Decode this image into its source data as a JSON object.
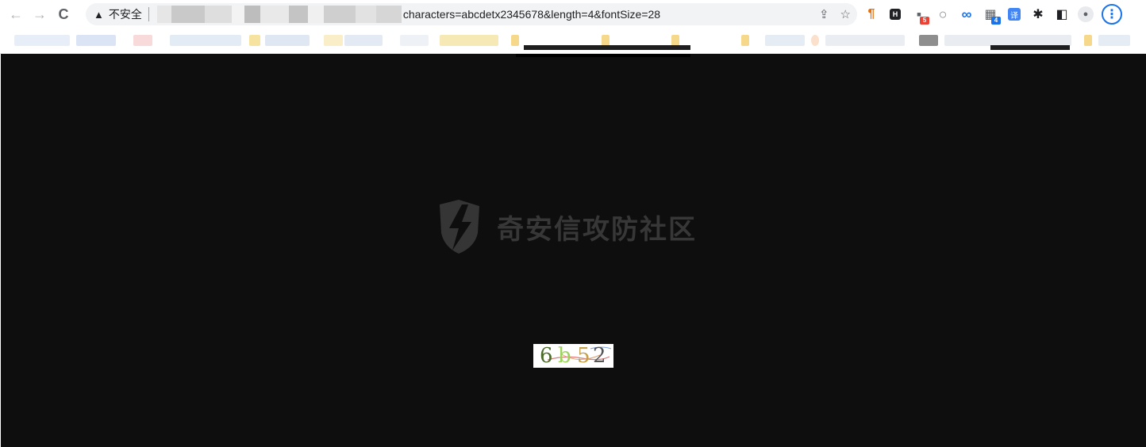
{
  "browser": {
    "nav": {
      "back_icon": "←",
      "forward_icon": "→",
      "reload_icon": "C"
    },
    "omnibox": {
      "security_icon": "▲",
      "security_label": "不安全",
      "url_visible": "characters=abcdetx2345678&length=4&fontSize=28",
      "share_icon": "⇪",
      "star_icon": "☆"
    },
    "extensions": [
      {
        "name": "pilcrow",
        "glyph": "¶",
        "color": "#e8710a",
        "badge": ""
      },
      {
        "name": "h-box",
        "glyph": "H",
        "color": "#202124",
        "badge": ""
      },
      {
        "name": "grid",
        "glyph": "▪",
        "color": "#5f6368",
        "badge": "5",
        "badge_color": "#ea4335"
      },
      {
        "name": "ring",
        "glyph": "○",
        "color": "#80868b",
        "badge": ""
      },
      {
        "name": "infinity",
        "glyph": "∞",
        "color": "#1a73e8",
        "badge": ""
      },
      {
        "name": "qr",
        "glyph": "▦",
        "color": "#5f6368",
        "badge": "4",
        "badge_color": "#1a73e8"
      },
      {
        "name": "translate",
        "glyph": "译",
        "color": "#ffffff",
        "bg": "#4285f4",
        "badge": ""
      },
      {
        "name": "puzzle",
        "glyph": "✱",
        "color": "#202124",
        "badge": ""
      },
      {
        "name": "side-panel",
        "glyph": "◧",
        "color": "#202124",
        "badge": ""
      },
      {
        "name": "profile",
        "glyph": "●",
        "color": "#5f6368",
        "badge": ""
      }
    ],
    "menu_icon": "⋮"
  },
  "page": {
    "watermark_text": "奇安信攻防社区",
    "captcha": {
      "chars": [
        {
          "ch": "6",
          "color": "#4a6b2c"
        },
        {
          "ch": "b",
          "color": "#9bd45a"
        },
        {
          "ch": "5",
          "color": "#c5a04a"
        },
        {
          "ch": "2",
          "color": "#555555"
        }
      ]
    }
  },
  "colors": {
    "page_bg": "#0e0e0e",
    "omnibox_bg": "#f1f3f4",
    "accent": "#1a73e8"
  }
}
